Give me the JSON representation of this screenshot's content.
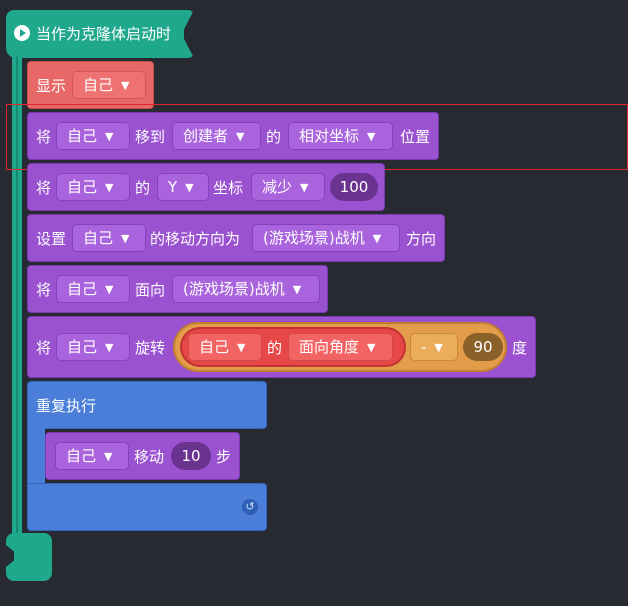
{
  "hat": {
    "label": "当作为克隆体启动时",
    "color": "#1fa88c"
  },
  "caret": "▼",
  "blocks": {
    "show": {
      "label": "显示",
      "target": "自己"
    },
    "move_to": {
      "prefix": "将",
      "target": "自己",
      "verb": "移到",
      "ref": "创建者",
      "of": "的",
      "mode": "相对坐标",
      "suffix": "位置"
    },
    "change_y": {
      "prefix": "将",
      "target": "自己",
      "of": "的",
      "axis": "Y",
      "coord": "坐标",
      "op": "减少",
      "value": "100"
    },
    "set_dir": {
      "prefix": "设置",
      "target": "自己",
      "text": "的移动方向为",
      "ref": "(游戏场景)战机",
      "suffix": "方向"
    },
    "face": {
      "prefix": "将",
      "target": "自己",
      "verb": "面向",
      "ref": "(游戏场景)战机"
    },
    "rotate": {
      "prefix": "将",
      "target": "自己",
      "verb": "旋转",
      "inner_target": "自己",
      "of": "的",
      "prop": "面向角度",
      "op": "-",
      "value": "90",
      "suffix": "度"
    },
    "repeat": {
      "label": "重复执行",
      "loop_icon": "↺"
    },
    "move": {
      "target": "自己",
      "verb": "移动",
      "value": "10",
      "suffix": "步"
    }
  },
  "colors": {
    "looks": "#e86868",
    "motion": "#9a52d0",
    "control": "#4a7ed8",
    "event": "#1fa88c",
    "selection": "#e0262c"
  }
}
